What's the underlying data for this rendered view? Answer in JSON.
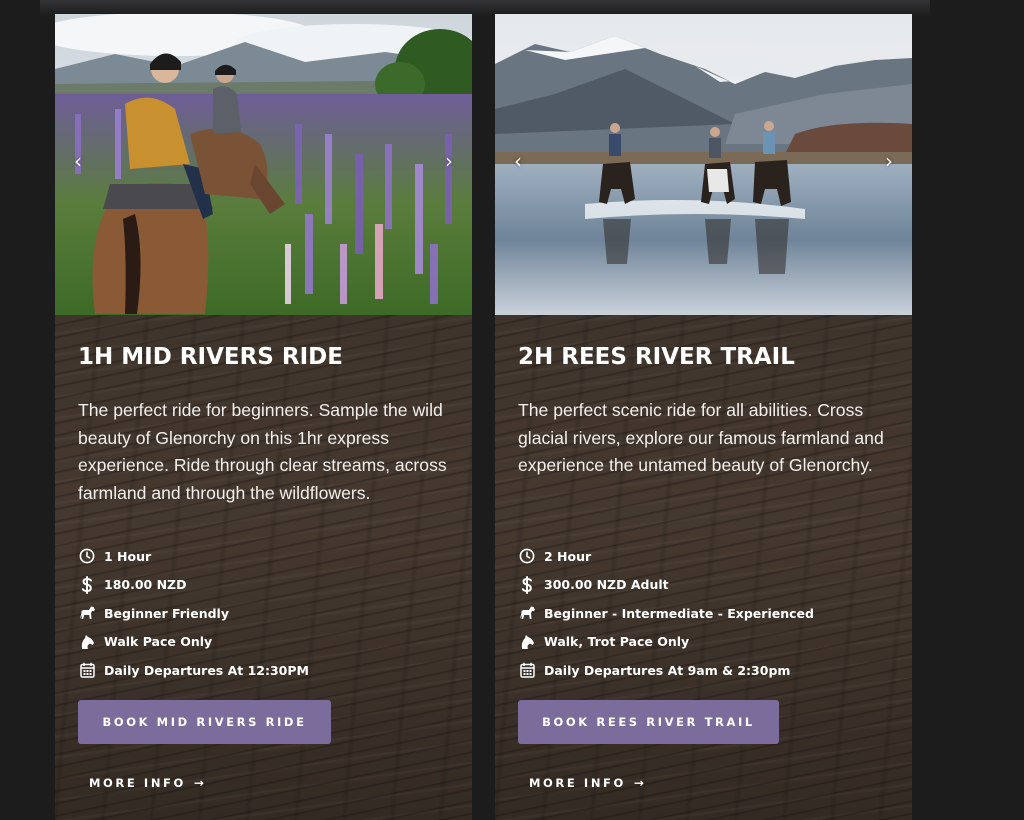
{
  "colors": {
    "page_background": "#1c1c1d",
    "book_button": "#7b6c9c",
    "text": "#ffffff"
  },
  "cards": [
    {
      "title": "1H MID RIVERS RIDE",
      "description": "The perfect ride for beginners. Sample the wild beauty of Glenorchy on this 1hr express experience. Ride through clear streams, across farmland and through the wildflowers.",
      "photo": "riders-in-lupin-field",
      "features": [
        {
          "icon": "clock-icon",
          "text": "1 Hour"
        },
        {
          "icon": "dollar-icon",
          "text": "180.00 NZD"
        },
        {
          "icon": "horse-icon",
          "text": "Beginner Friendly"
        },
        {
          "icon": "horse-head-icon",
          "text": "Walk Pace Only"
        },
        {
          "icon": "calendar-icon",
          "text": "Daily Departures At 12:30PM"
        }
      ],
      "book_label": "BOOK MID RIVERS RIDE",
      "more_label": "MORE INFO",
      "more_arrow": "→",
      "prev_arrow": "‹",
      "next_arrow": "›"
    },
    {
      "title": "2H REES RIVER TRAIL",
      "description": "The perfect scenic ride for all abilities. Cross glacial rivers, explore our famous farmland and experience the untamed beauty of Glenorchy.",
      "photo": "riders-crossing-river",
      "features": [
        {
          "icon": "clock-icon",
          "text": "2 Hour"
        },
        {
          "icon": "dollar-icon",
          "text": "300.00 NZD Adult"
        },
        {
          "icon": "horse-icon",
          "text": "Beginner - Intermediate - Experienced"
        },
        {
          "icon": "horse-head-icon",
          "text": "Walk, Trot Pace Only"
        },
        {
          "icon": "calendar-icon",
          "text": "Daily Departures At 9am & 2:30pm"
        }
      ],
      "book_label": "BOOK REES RIVER TRAIL",
      "more_label": "MORE INFO",
      "more_arrow": "→",
      "prev_arrow": "‹",
      "next_arrow": "›"
    }
  ]
}
